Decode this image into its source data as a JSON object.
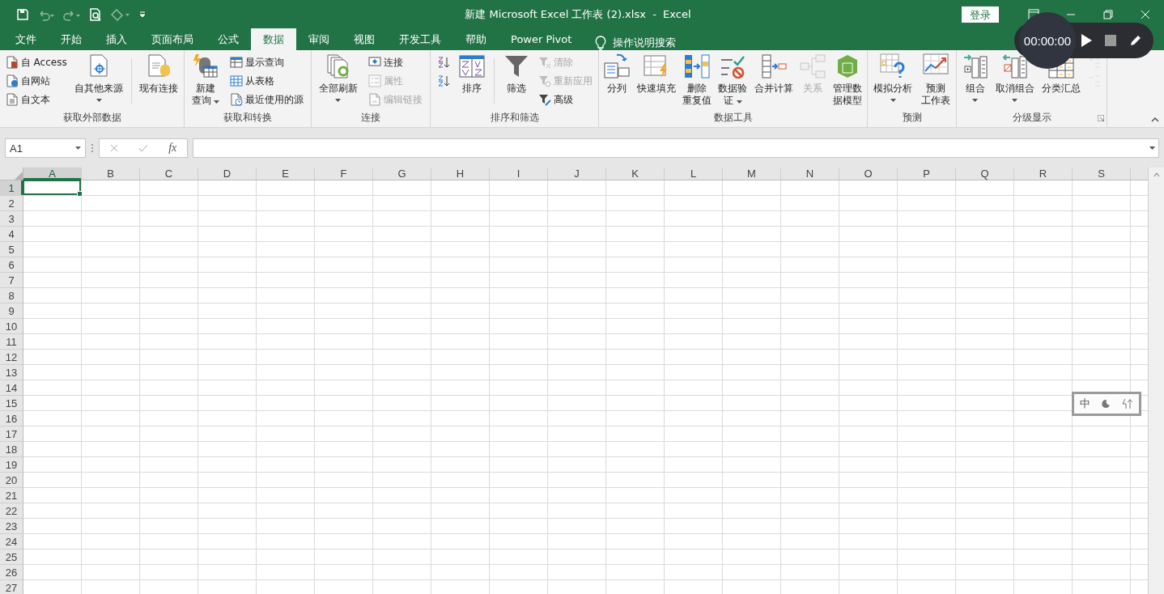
{
  "window": {
    "title": "新建 Microsoft Excel 工作表 (2).xlsx  -  Excel",
    "login": "登录"
  },
  "tabs": [
    {
      "label": "文件",
      "selected": false
    },
    {
      "label": "开始",
      "selected": false
    },
    {
      "label": "插入",
      "selected": false
    },
    {
      "label": "页面布局",
      "selected": false
    },
    {
      "label": "公式",
      "selected": false
    },
    {
      "label": "数据",
      "selected": true
    },
    {
      "label": "审阅",
      "selected": false
    },
    {
      "label": "视图",
      "selected": false
    },
    {
      "label": "开发工具",
      "selected": false
    },
    {
      "label": "帮助",
      "selected": false
    },
    {
      "label": "Power Pivot",
      "selected": false
    }
  ],
  "tell_me": "操作说明搜索",
  "ribbon_groups": [
    {
      "label": "获取外部数据",
      "items": [
        {
          "kind": "stack",
          "items": [
            {
              "label": "自 Access",
              "disabled": false
            },
            {
              "label": "自网站",
              "disabled": false
            },
            {
              "label": "自文本",
              "disabled": false
            }
          ]
        },
        {
          "kind": "large",
          "label": [
            "自其他来源"
          ],
          "dropdown": true,
          "disabled": false
        },
        {
          "kind": "separator"
        },
        {
          "kind": "large",
          "label": [
            "现有连接"
          ],
          "dropdown": false,
          "disabled": false
        }
      ]
    },
    {
      "label": "获取和转换",
      "items": [
        {
          "kind": "large",
          "label": [
            "新建",
            "查询"
          ],
          "dropdown": true,
          "disabled": false
        },
        {
          "kind": "stack",
          "items": [
            {
              "label": "显示查询",
              "disabled": false
            },
            {
              "label": "从表格",
              "disabled": false
            },
            {
              "label": "最近使用的源",
              "disabled": false
            }
          ]
        }
      ]
    },
    {
      "label": "连接",
      "items": [
        {
          "kind": "large",
          "label": [
            "全部刷新"
          ],
          "dropdown": true,
          "disabled": false
        },
        {
          "kind": "stack",
          "items": [
            {
              "label": "连接",
              "disabled": false
            },
            {
              "label": "属性",
              "disabled": true
            },
            {
              "label": "编辑链接",
              "disabled": true
            }
          ]
        }
      ]
    },
    {
      "label": "排序和筛选",
      "items": [
        {
          "kind": "stack",
          "items": [
            {
              "disabled": false
            },
            {
              "disabled": false
            }
          ]
        },
        {
          "kind": "large",
          "label": [
            "排序"
          ],
          "dropdown": false,
          "disabled": false
        },
        {
          "kind": "separator"
        },
        {
          "kind": "large",
          "label": [
            "筛选"
          ],
          "dropdown": false,
          "disabled": false
        },
        {
          "kind": "stack",
          "items": [
            {
              "label": "清除",
              "disabled": true
            },
            {
              "label": "重新应用",
              "disabled": true
            },
            {
              "label": "高级",
              "disabled": false
            }
          ]
        }
      ]
    },
    {
      "label": "数据工具",
      "items": [
        {
          "kind": "large",
          "label": [
            "分列"
          ],
          "dropdown": false,
          "disabled": false
        },
        {
          "kind": "large",
          "label": [
            "快速填充"
          ],
          "dropdown": false,
          "disabled": false
        },
        {
          "kind": "large",
          "label": [
            "删除",
            "重复值"
          ],
          "dropdown": false,
          "disabled": false
        },
        {
          "kind": "large",
          "label": [
            "数据验",
            "证"
          ],
          "dropdown": true,
          "disabled": false
        },
        {
          "kind": "large",
          "label": [
            "合并计算"
          ],
          "dropdown": false,
          "disabled": false
        },
        {
          "kind": "large",
          "label": [
            "关系"
          ],
          "dropdown": false,
          "disabled": true
        },
        {
          "kind": "large",
          "label": [
            "管理数",
            "据模型"
          ],
          "dropdown": false,
          "disabled": false
        }
      ]
    },
    {
      "label": "预测",
      "items": [
        {
          "kind": "large",
          "label": [
            "模拟分析"
          ],
          "dropdown": true,
          "disabled": false
        },
        {
          "kind": "large",
          "label": [
            "预测",
            "工作表"
          ],
          "dropdown": false,
          "disabled": false
        }
      ]
    },
    {
      "label": "分级显示",
      "launcher": true,
      "items": [
        {
          "kind": "large",
          "label": [
            "组合"
          ],
          "dropdown": true,
          "disabled": false
        },
        {
          "kind": "large",
          "label": [
            "取消组合"
          ],
          "dropdown": true,
          "disabled": false
        },
        {
          "kind": "large",
          "label": [
            "分类汇总"
          ],
          "dropdown": false,
          "disabled": false
        },
        {
          "kind": "stack",
          "items": [
            {
              "disabled": true
            },
            {
              "disabled": true
            }
          ]
        }
      ]
    }
  ],
  "name_box": "A1",
  "formula_fx": "fx",
  "columns": [
    {
      "label": "A",
      "selected": true
    },
    {
      "label": "B",
      "selected": false
    },
    {
      "label": "C",
      "selected": false
    },
    {
      "label": "D",
      "selected": false
    },
    {
      "label": "E",
      "selected": false
    },
    {
      "label": "F",
      "selected": false
    },
    {
      "label": "G",
      "selected": false
    },
    {
      "label": "H",
      "selected": false
    },
    {
      "label": "I",
      "selected": false
    },
    {
      "label": "J",
      "selected": false
    },
    {
      "label": "K",
      "selected": false
    },
    {
      "label": "L",
      "selected": false
    },
    {
      "label": "M",
      "selected": false
    },
    {
      "label": "N",
      "selected": false
    },
    {
      "label": "O",
      "selected": false
    },
    {
      "label": "P",
      "selected": false
    },
    {
      "label": "Q",
      "selected": false
    },
    {
      "label": "R",
      "selected": false
    },
    {
      "label": "S",
      "selected": false
    }
  ],
  "rows": [
    {
      "label": "1",
      "selected": true
    },
    {
      "label": "2",
      "selected": false
    },
    {
      "label": "3",
      "selected": false
    },
    {
      "label": "4",
      "selected": false
    },
    {
      "label": "5",
      "selected": false
    },
    {
      "label": "6",
      "selected": false
    },
    {
      "label": "7",
      "selected": false
    },
    {
      "label": "8",
      "selected": false
    },
    {
      "label": "9",
      "selected": false
    },
    {
      "label": "10",
      "selected": false
    },
    {
      "label": "11",
      "selected": false
    },
    {
      "label": "12",
      "selected": false
    },
    {
      "label": "13",
      "selected": false
    },
    {
      "label": "14",
      "selected": false
    },
    {
      "label": "15",
      "selected": false
    },
    {
      "label": "16",
      "selected": false
    },
    {
      "label": "17",
      "selected": false
    },
    {
      "label": "18",
      "selected": false
    },
    {
      "label": "19",
      "selected": false
    },
    {
      "label": "20",
      "selected": false
    },
    {
      "label": "21",
      "selected": false
    },
    {
      "label": "22",
      "selected": false
    },
    {
      "label": "23",
      "selected": false
    },
    {
      "label": "24",
      "selected": false
    },
    {
      "label": "25",
      "selected": false
    },
    {
      "label": "26",
      "selected": false
    },
    {
      "label": "27",
      "selected": false
    }
  ],
  "recorder": {
    "time": "00:00:00"
  },
  "ime": {
    "label": "中"
  }
}
